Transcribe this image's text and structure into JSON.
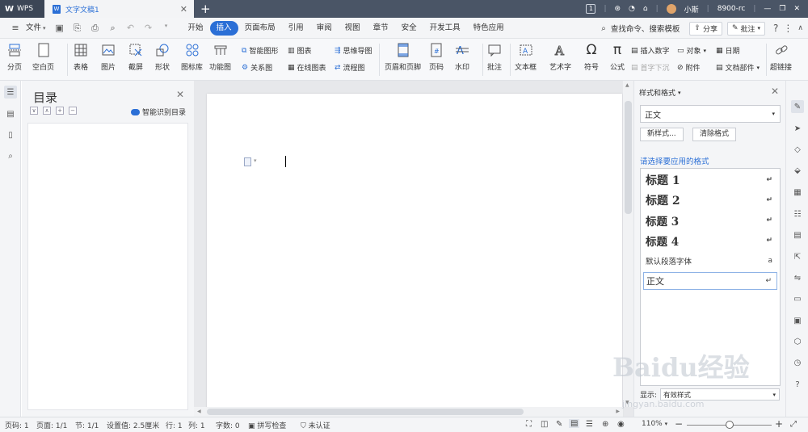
{
  "titlebar": {
    "app_name": "WPS",
    "doc_tab": "文字文稿1",
    "page_badge": "1",
    "user_name": "小斯",
    "user_id": "8900-rc"
  },
  "menubar": {
    "file_label": "文件",
    "tabs": [
      "开始",
      "插入",
      "页面布局",
      "引用",
      "审阅",
      "视图",
      "章节",
      "安全",
      "开发工具",
      "特色应用"
    ],
    "active_tab": "插入",
    "search_label": "查找命令、搜索模板",
    "share_label": "分享",
    "comment_label": "批注"
  },
  "ribbon": {
    "page_break": "分页",
    "blank_page": "空白页",
    "table": "表格",
    "picture": "图片",
    "screenshot": "截屏",
    "shape": "形状",
    "icon_lib": "图标库",
    "func_chart": "功能图",
    "smart_art": "智能图形",
    "relation": "关系图",
    "chart": "图表",
    "online_chart": "在线图表",
    "mindmap": "思维导图",
    "flowchart": "流程图",
    "header_footer": "页眉和页脚",
    "page_number": "页码",
    "watermark": "水印",
    "comment": "批注",
    "textbox": "文本框",
    "wordart": "艺术字",
    "symbol": "符号",
    "formula": "公式",
    "insert_number": "插入数字",
    "drop_cap": "首字下沉",
    "object": "对象",
    "attachment": "附件",
    "date": "日期",
    "doc_parts": "文档部件",
    "hyperlink": "超链接"
  },
  "toc": {
    "title": "目录",
    "smart_label": "智能识别目录"
  },
  "styles_panel": {
    "title": "样式和格式",
    "current_style": "正文",
    "new_style": "新样式...",
    "clear_format": "清除格式",
    "prompt": "请选择要应用的格式",
    "items": [
      {
        "label": "标题 1",
        "mark": "↵"
      },
      {
        "label": "标题 2",
        "mark": "↵"
      },
      {
        "label": "标题 3",
        "mark": "↵"
      },
      {
        "label": "标题 4",
        "mark": "↵"
      },
      {
        "label": "默认段落字体",
        "mark": "a"
      },
      {
        "label": "正文",
        "mark": "↵"
      }
    ],
    "show_label": "显示:",
    "show_value": "有效样式"
  },
  "statusbar": {
    "page_num": "页码: 1",
    "pages": "页面: 1/1",
    "section": "节: 1/1",
    "setting": "设置值: 2.5厘米",
    "line": "行: 1",
    "column": "列: 1",
    "words": "字数: 0",
    "spell_check": "拼写检查",
    "cert": "未认证",
    "zoom": "110%"
  },
  "watermark": {
    "logo": "Baidu经验",
    "url": "jingyan.baidu.com"
  },
  "colors": {
    "accent": "#2b6fd6",
    "titlebar": "#4a5566"
  }
}
